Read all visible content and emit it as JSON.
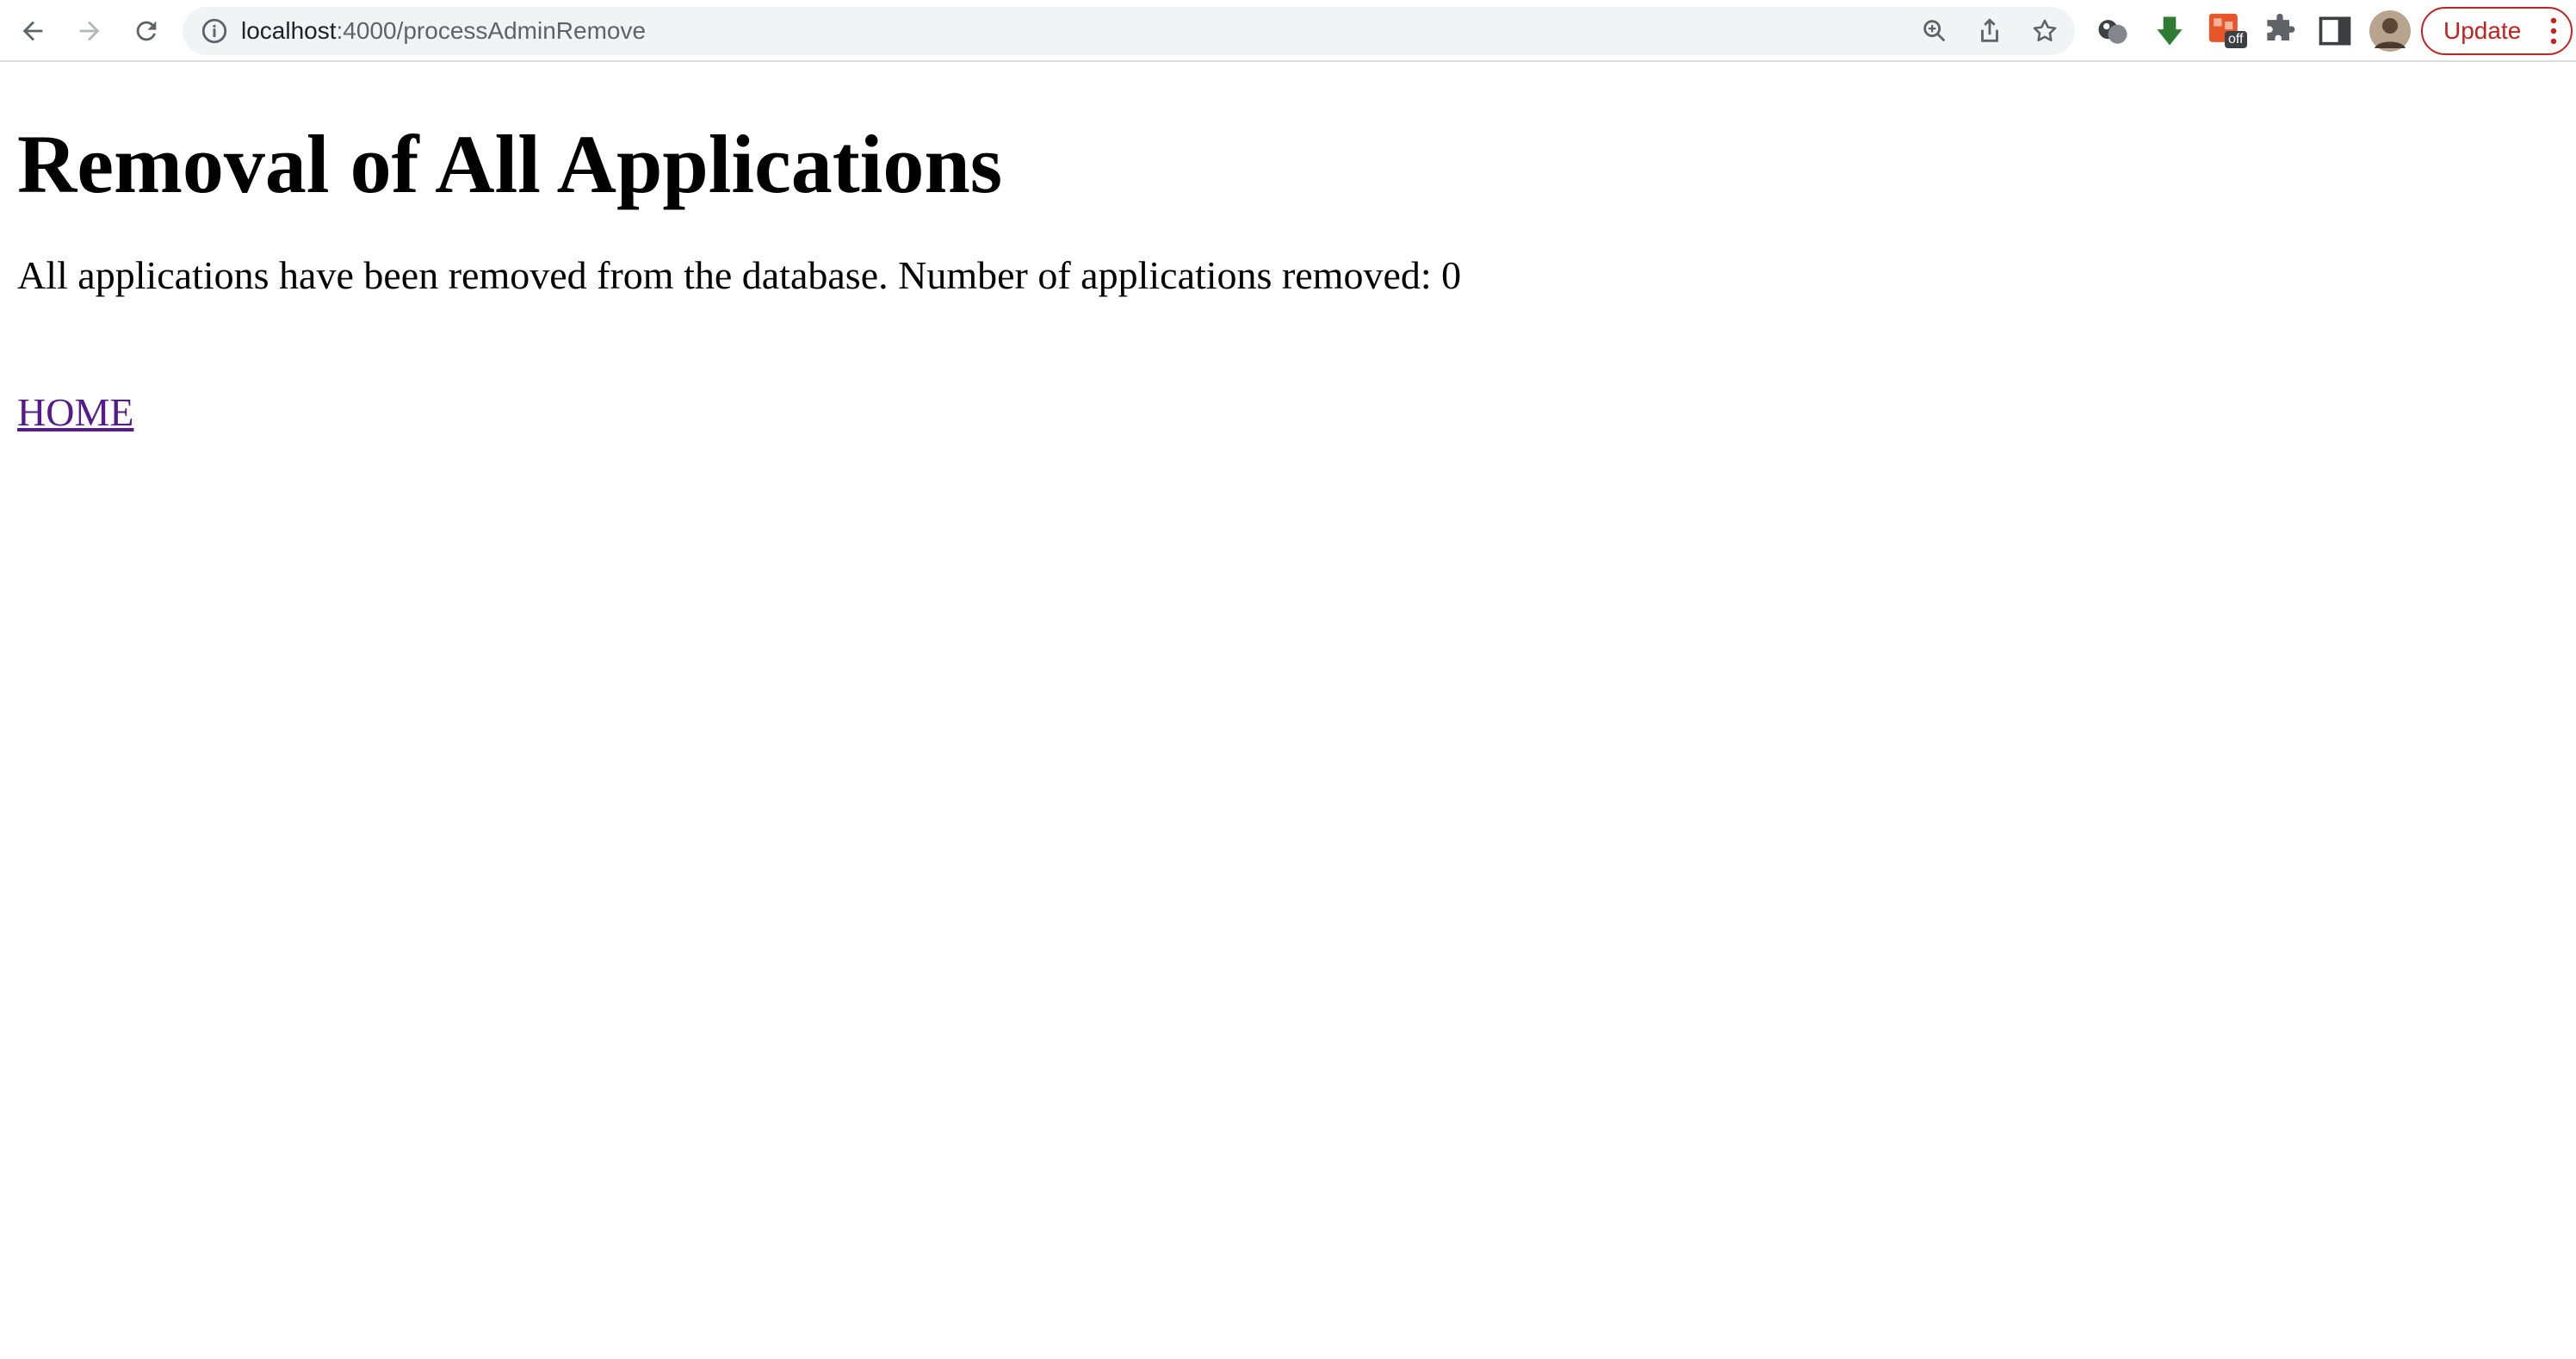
{
  "browser": {
    "url_host": "localhost",
    "url_path": ":4000/processAdminRemove",
    "update_label": "Update",
    "extension_badge": "off"
  },
  "page": {
    "heading": "Removal of All Applications",
    "message": "All applications have been removed from the database. Number of applications removed: 0",
    "home_link": "HOME"
  },
  "colors": {
    "update": "#c5221f",
    "visited_link": "#551a8b",
    "extension_green": "#2e7d32",
    "extension_orange": "#e8572a"
  }
}
